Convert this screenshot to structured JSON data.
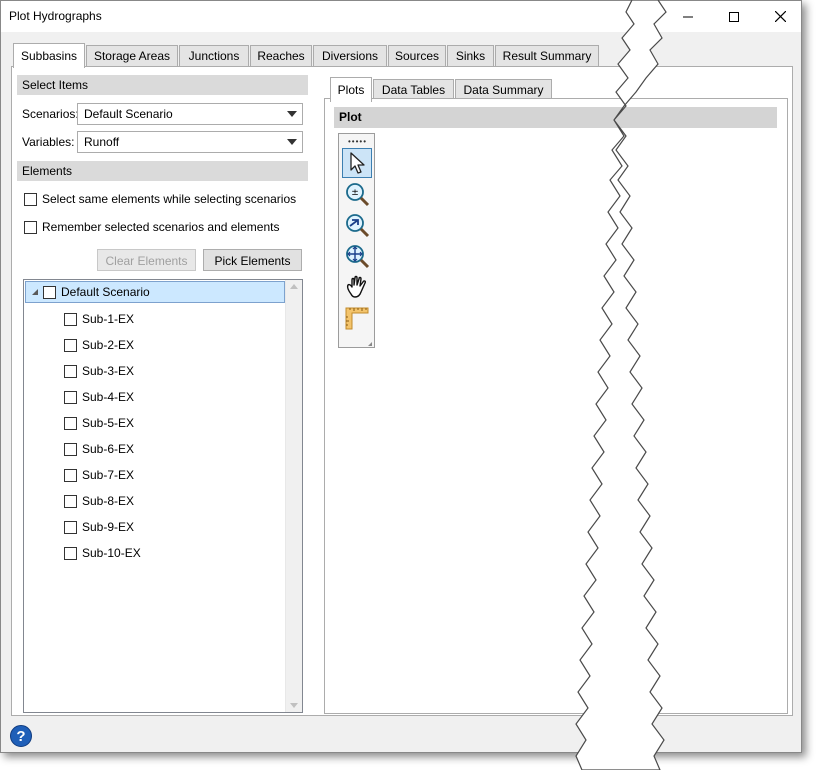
{
  "window": {
    "title": "Plot Hydrographs"
  },
  "main_tabs": [
    {
      "label": "Subbasins",
      "active": true
    },
    {
      "label": "Storage Areas",
      "active": false
    },
    {
      "label": "Junctions",
      "active": false
    },
    {
      "label": "Reaches",
      "active": false
    },
    {
      "label": "Diversions",
      "active": false
    },
    {
      "label": "Sources",
      "active": false
    },
    {
      "label": "Sinks",
      "active": false
    },
    {
      "label": "Result Summary",
      "active": false
    }
  ],
  "select_items": {
    "header": "Select Items",
    "scenarios_label": "Scenarios:",
    "scenarios_value": "Default Scenario",
    "variables_label": "Variables:",
    "variables_value": "Runoff"
  },
  "elements": {
    "header": "Elements",
    "checkbox_same": "Select same elements while selecting scenarios",
    "checkbox_remember": "Remember selected scenarios and elements",
    "clear_button": "Clear Elements",
    "pick_button": "Pick Elements",
    "tree_root": "Default Scenario",
    "tree_items": [
      "Sub-1-EX",
      "Sub-2-EX",
      "Sub-3-EX",
      "Sub-4-EX",
      "Sub-5-EX",
      "Sub-6-EX",
      "Sub-7-EX",
      "Sub-8-EX",
      "Sub-9-EX",
      "Sub-10-EX"
    ]
  },
  "right_tabs": [
    {
      "label": "Plots",
      "active": true
    },
    {
      "label": "Data Tables",
      "active": false
    },
    {
      "label": "Data Summary",
      "active": false
    }
  ],
  "plot": {
    "header": "Plot",
    "tools": [
      "pointer-icon",
      "zoom-in-out-icon",
      "zoom-previous-icon",
      "zoom-extents-icon",
      "pan-hand-icon",
      "measure-ruler-icon"
    ]
  },
  "colors": {
    "accent": "#1f5fb8",
    "selected_bg": "#cce8ff"
  }
}
